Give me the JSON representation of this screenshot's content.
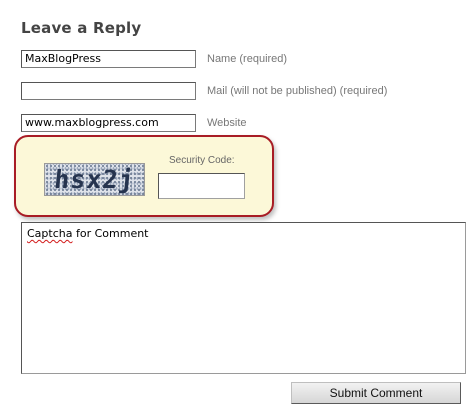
{
  "form": {
    "heading": "Leave a Reply",
    "name_field": {
      "value": "MaxBlogPress",
      "label": "Name (required)"
    },
    "mail_field": {
      "value": "",
      "label": "Mail (will not be published) (required)"
    },
    "website_field": {
      "value": "www.maxblogpress.com",
      "label": "Website"
    },
    "captcha": {
      "image_text": "hsx2j",
      "security_label": "Security Code:",
      "security_value": "",
      "highlight_border_color": "#a81c25",
      "highlight_background": "#fcf8d8"
    },
    "comment": {
      "misspelled_word": "Captcha",
      "rest_text": " for Comment"
    },
    "submit_label": "Submit Comment"
  }
}
